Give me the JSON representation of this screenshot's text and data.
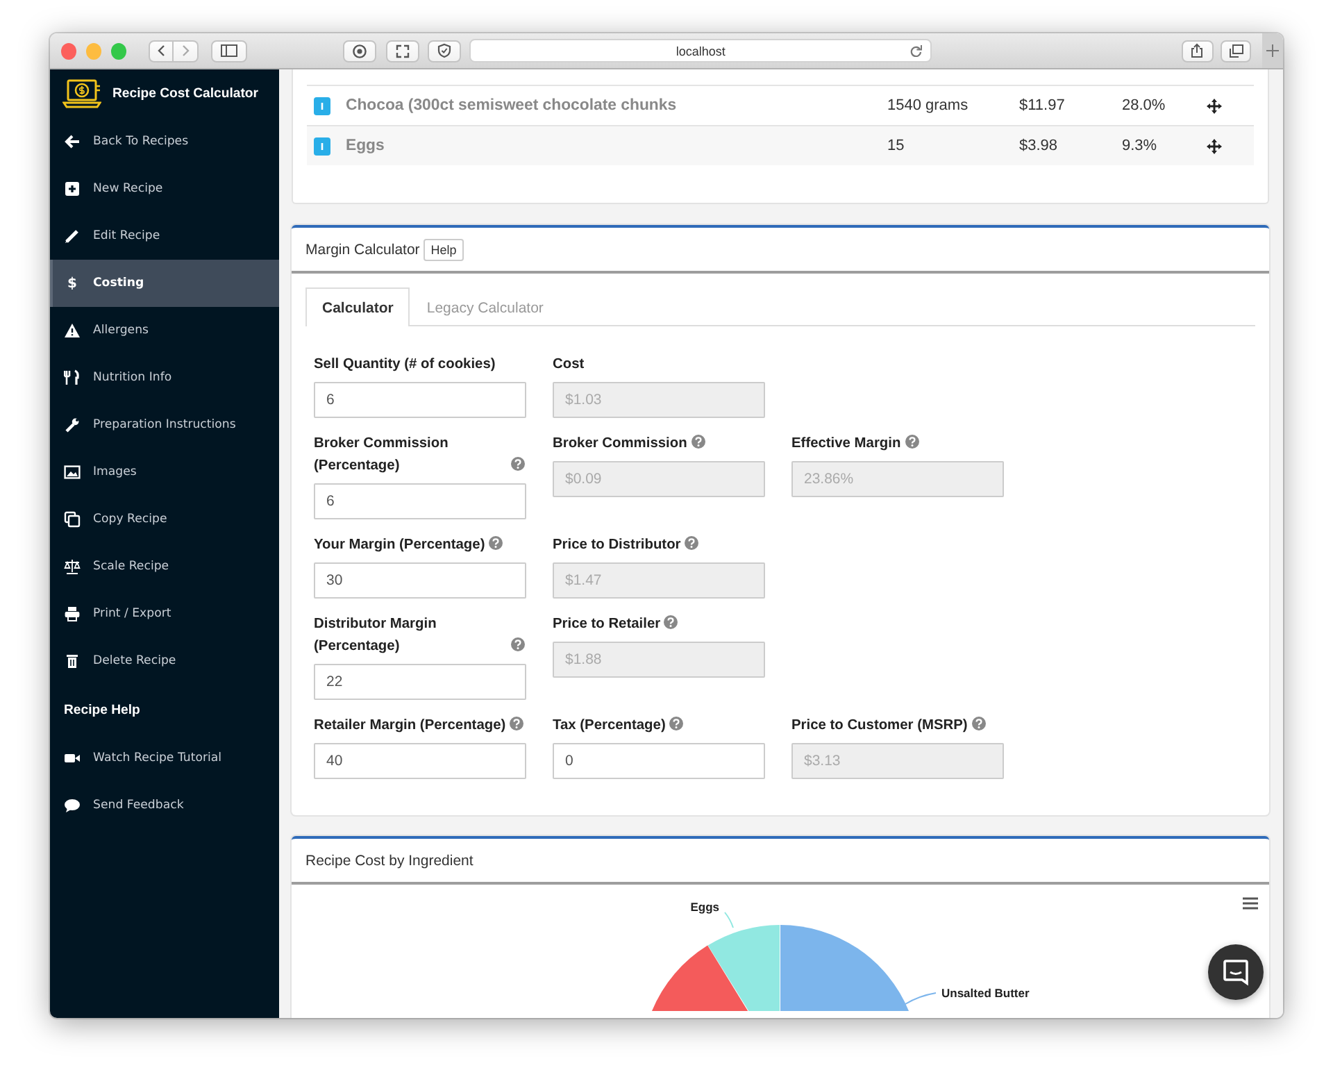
{
  "browser": {
    "url": "localhost"
  },
  "sidebar": {
    "title": "Recipe Cost Calculator",
    "items": [
      {
        "label": "Back To Recipes",
        "selected": false
      },
      {
        "label": "New Recipe",
        "selected": false
      },
      {
        "label": "Edit Recipe",
        "selected": false
      },
      {
        "label": "Costing",
        "glyph": "$",
        "selected": true
      },
      {
        "label": "Allergens",
        "selected": false
      },
      {
        "label": "Nutrition Info",
        "selected": false
      },
      {
        "label": "Preparation Instructions",
        "selected": false
      },
      {
        "label": "Images",
        "selected": false
      },
      {
        "label": "Copy Recipe",
        "selected": false
      },
      {
        "label": "Scale Recipe",
        "selected": false
      },
      {
        "label": "Print / Export",
        "selected": false
      },
      {
        "label": "Delete Recipe",
        "selected": false
      }
    ],
    "help_heading": "Recipe Help",
    "help_items": [
      {
        "label": "Watch Recipe Tutorial",
        "selected": false
      },
      {
        "label": "Send Feedback",
        "selected": false
      }
    ]
  },
  "ingredients": [
    {
      "name": "Chocoa (300ct semisweet chocolate chunks",
      "quantity": "1540 grams",
      "cost": "$11.97",
      "share": "28.0%"
    },
    {
      "name": "Eggs",
      "quantity": "15",
      "cost": "$3.98",
      "share": "9.3%"
    }
  ],
  "margin_calculator": {
    "title": "Margin Calculator",
    "help_button": "Help",
    "tabs": [
      {
        "label": "Calculator",
        "selected": true
      },
      {
        "label": "Legacy Calculator",
        "selected": false
      }
    ],
    "rows": [
      [
        {
          "kind": "field",
          "label": "Sell Quantity (# of cookies)",
          "help": false,
          "value": "6",
          "readonly": false
        },
        {
          "kind": "field",
          "label": "Cost",
          "help": false,
          "value": "$1.03",
          "readonly": true
        },
        {
          "kind": "empty"
        }
      ],
      [
        {
          "kind": "field",
          "label": "Broker Commission (Percentage)",
          "help": true,
          "value": "6",
          "readonly": false
        },
        {
          "kind": "field",
          "label": "Broker Commission",
          "help": true,
          "value": "$0.09",
          "readonly": true
        },
        {
          "kind": "field",
          "label": "Effective Margin",
          "help": true,
          "value": "23.86%",
          "readonly": true
        }
      ],
      [
        {
          "kind": "field",
          "label": "Your Margin (Percentage)",
          "help": true,
          "value": "30",
          "readonly": false
        },
        {
          "kind": "field",
          "label": "Price to Distributor",
          "help": true,
          "value": "$1.47",
          "readonly": true
        },
        {
          "kind": "empty"
        }
      ],
      [
        {
          "kind": "field",
          "label": "Distributor Margin (Percentage)",
          "help": true,
          "value": "22",
          "readonly": false
        },
        {
          "kind": "field",
          "label": "Price to Retailer",
          "help": true,
          "value": "$1.88",
          "readonly": true
        },
        {
          "kind": "empty"
        }
      ],
      [
        {
          "kind": "field",
          "label": "Retailer Margin (Percentage)",
          "help": true,
          "value": "40",
          "readonly": false
        },
        {
          "kind": "field",
          "label": "Tax (Percentage)",
          "help": true,
          "value": "0",
          "readonly": false
        },
        {
          "kind": "field",
          "label": "Price to Customer (MSRP)",
          "help": true,
          "value": "$3.13",
          "readonly": true
        }
      ]
    ]
  },
  "cost_chart": {
    "title": "Recipe Cost by Ingredient",
    "slices": [
      {
        "label": "Unsalted Butter",
        "color": "#7cb5ec"
      },
      {
        "color": "#f45b5b"
      },
      {
        "label": "Eggs",
        "color": "#91e8e1"
      }
    ]
  }
}
